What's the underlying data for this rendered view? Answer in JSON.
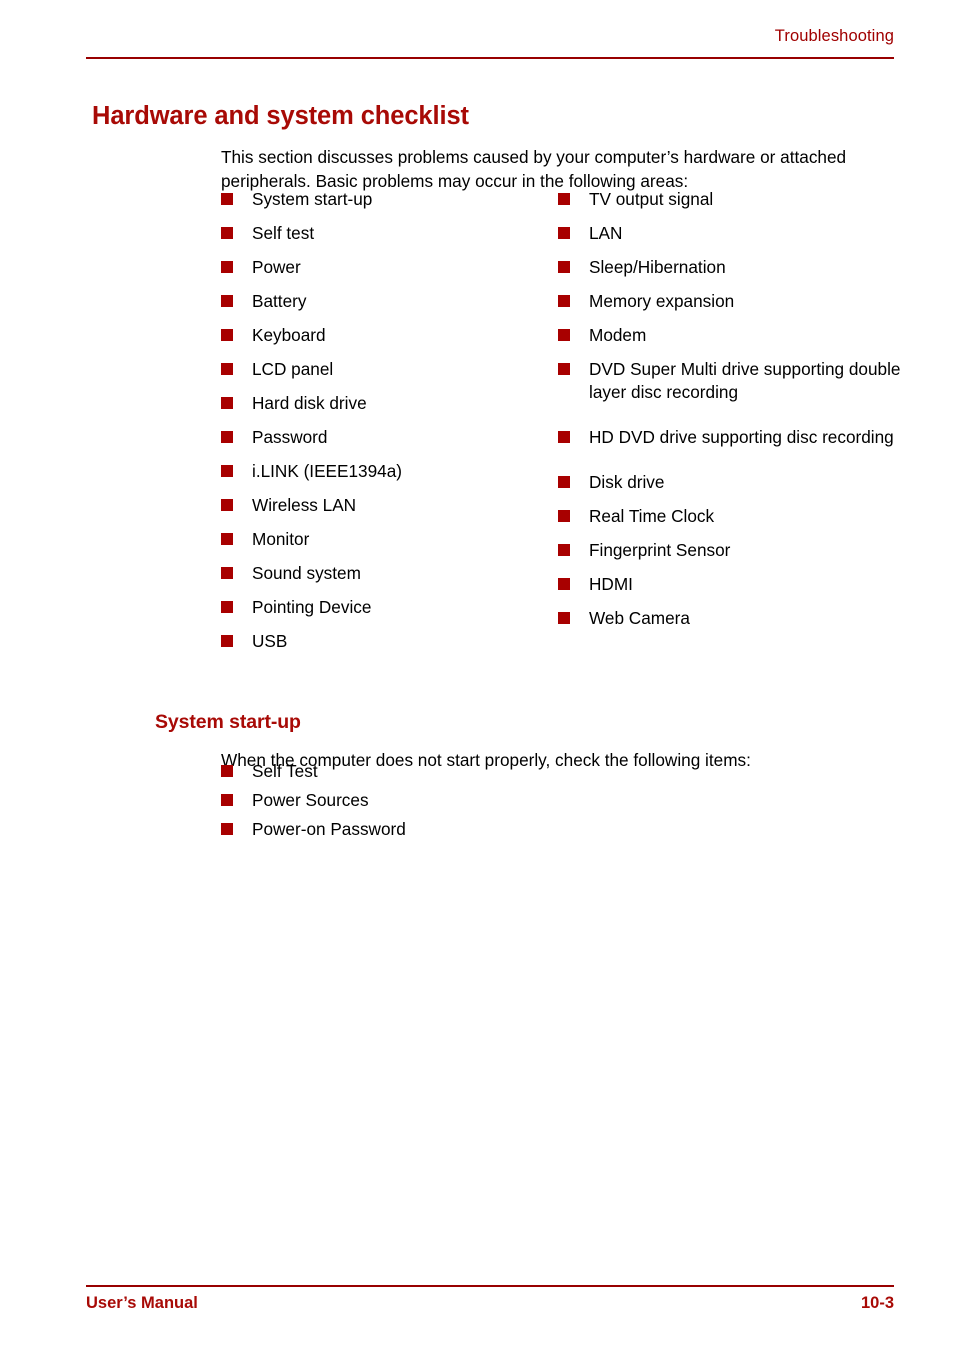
{
  "header": {
    "title": "Troubleshooting"
  },
  "title": "Hardware and system checklist",
  "intro": "This section discusses problems caused by your computer’s hardware or attached peripherals. Basic problems may occur in the following areas:",
  "checklist": {
    "left": [
      "System start-up",
      "Self test",
      "Power",
      "Battery",
      "Keyboard",
      "LCD panel",
      "Hard disk drive",
      "Password",
      "i.LINK (IEEE1394a)",
      "Wireless LAN",
      "Monitor",
      "Sound system",
      "Pointing Device",
      "USB"
    ],
    "right": [
      "TV output signal",
      "LAN",
      "Sleep/Hibernation",
      "Memory expansion",
      "Modem",
      "DVD Super Multi drive supporting double layer disc recording",
      "HD DVD drive supporting disc recording",
      "Disk drive",
      "Real Time Clock",
      "Fingerprint Sensor",
      "HDMI",
      "Web Camera"
    ]
  },
  "subsection": {
    "heading": "System start-up",
    "intro": "When the computer does not start properly, check the following items:",
    "items": [
      "Self Test",
      "Power Sources",
      "Power-on Password"
    ]
  },
  "footer": {
    "left": "User’s Manual",
    "right": "10-3"
  },
  "colors": {
    "accent_red": "#a80a06",
    "rule_red": "#980000",
    "bullet_red": "#a80000",
    "text_black": "#000000",
    "page_background": "#ffffff"
  }
}
